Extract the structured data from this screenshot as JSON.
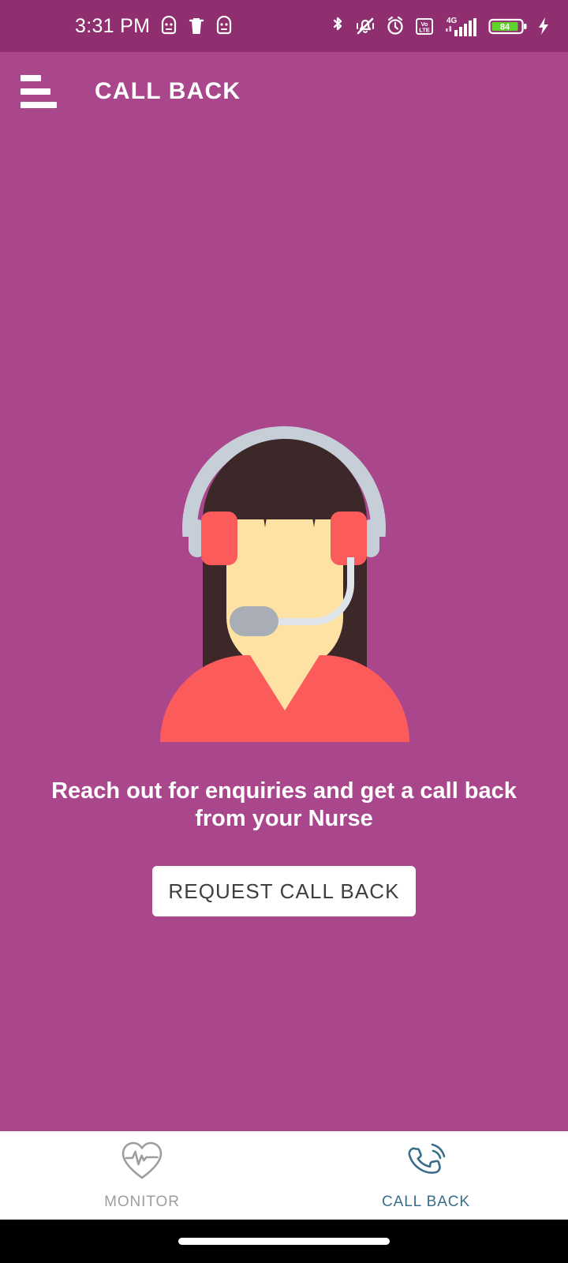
{
  "status_bar": {
    "time": "3:31 PM",
    "left_icons": [
      "android-notification-icon",
      "trash-icon",
      "android-notification-icon"
    ],
    "right_icons": [
      "bluetooth-icon",
      "vibrate-mute-icon",
      "alarm-clock-icon",
      "volte-icon",
      "network-4g-icon",
      "signal-bars-icon",
      "battery-icon",
      "charging-bolt-icon"
    ],
    "network_type": "4G",
    "volte_label_top": "Vo",
    "volte_label_bottom": "LTE",
    "battery_percent": "84",
    "background_color": "#8f2f70"
  },
  "app_bar": {
    "menu_icon": "hamburger-menu-icon",
    "title": "CALL BACK"
  },
  "hero": {
    "illustration_name": "call-center-nurse-illustration",
    "colors": {
      "hair": "#3c2828",
      "skin": "#fde2a4",
      "shirt": "#fc5b5b",
      "headset_band": "#c6ced8",
      "mic": "#a9aeb6"
    }
  },
  "main": {
    "tagline": "Reach out for enquiries and get a call back from your Nurse",
    "cta_label": "REQUEST CALL BACK",
    "background_color": "#a9468c"
  },
  "bottom_nav": {
    "items": [
      {
        "label": "MONITOR",
        "icon": "heart-pulse-icon",
        "active": false,
        "color": "#9e9e9e"
      },
      {
        "label": "CALL BACK",
        "icon": "phone-ring-icon",
        "active": true,
        "color": "#3a6d8a"
      }
    ]
  }
}
